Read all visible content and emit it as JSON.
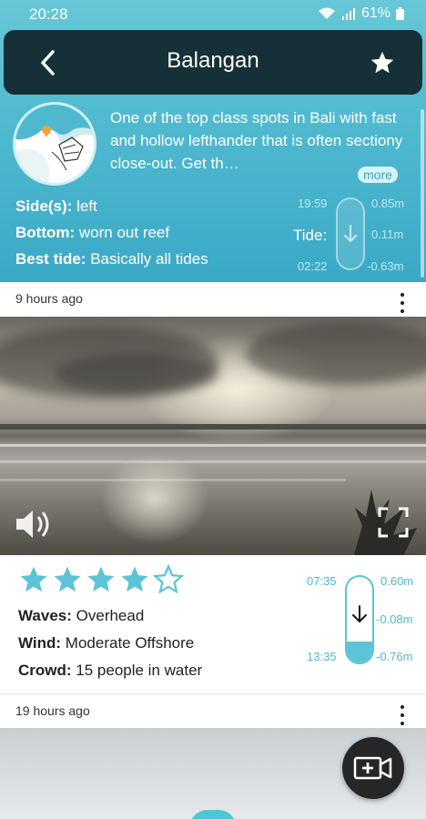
{
  "status_bar": {
    "time": "20:28",
    "battery": "61%"
  },
  "header": {
    "title": "Balangan"
  },
  "spot": {
    "description": "One of the top class spots in Bali with fast and hollow lefthander that is often sectiony close-out. Get th…",
    "more_label": "more",
    "sides_label": "Side(s):",
    "sides_value": "left",
    "bottom_label": "Bottom:",
    "bottom_value": "worn out reef",
    "best_tide_label": "Best tide:",
    "best_tide_value": "Basically all tides",
    "tide_label": "Tide:",
    "tide_time_high": "19:59",
    "tide_time_low": "02:22",
    "tide_high": "0.85m",
    "tide_current": "0.11m",
    "tide_low": "-0.63m"
  },
  "posts": [
    {
      "time_ago": "9 hours ago",
      "rating": 4,
      "rating_max": 5,
      "waves_label": "Waves:",
      "waves_value": "Overhead",
      "wind_label": "Wind:",
      "wind_value": "Moderate Offshore",
      "crowd_label": "Crowd:",
      "crowd_value": "15 people in water",
      "tide_time_high": "07:35",
      "tide_time_low": "13:35",
      "tide_high": "0.60m",
      "tide_current": "-0.08m",
      "tide_low": "-0.76m",
      "tide_level": 0.25
    },
    {
      "time_ago": "19 hours ago"
    }
  ],
  "colors": {
    "accent": "#4fb9cf",
    "header_bg": "#163038",
    "star": "#5cc4d6"
  },
  "icons": {
    "back": "chevron-left-icon",
    "favorite": "star-icon",
    "sound": "volume-icon",
    "fullscreen": "fullscreen-icon",
    "menu": "more-vertical-icon",
    "camera": "add-video-icon",
    "tide_arrow": "arrow-down-icon"
  }
}
